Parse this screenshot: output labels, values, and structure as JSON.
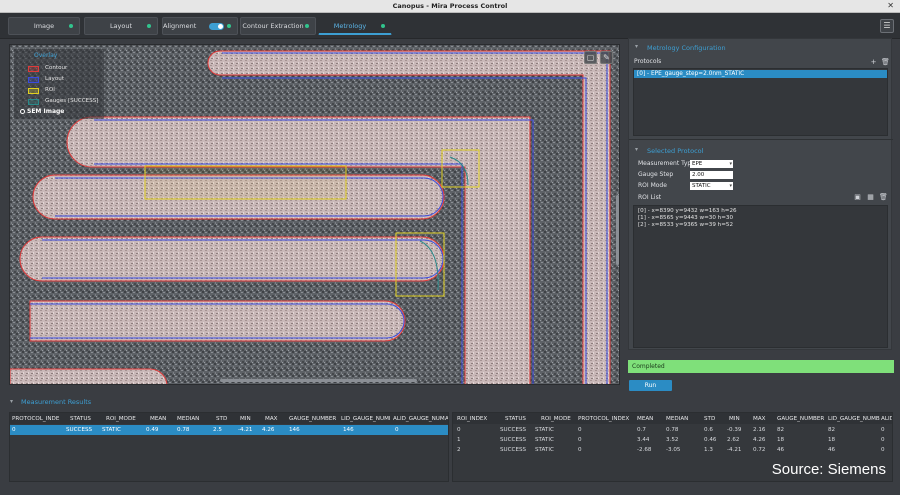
{
  "window": {
    "title": "Canopus - Mira Process Control",
    "close_glyph": "✕"
  },
  "tabs": [
    {
      "label": "Image"
    },
    {
      "label": "Layout"
    },
    {
      "label": "Alignment"
    },
    {
      "label": "Contour Extraction"
    },
    {
      "label": "Metrology"
    }
  ],
  "menu_glyph": "☰",
  "viewer": {
    "legend": {
      "header": "Overlay",
      "items": [
        {
          "label": "Contour",
          "color": "#e03a3a"
        },
        {
          "label": "Layout",
          "color": "#3a4be0"
        },
        {
          "label": "ROI",
          "color": "#e0d020"
        },
        {
          "label": "Gauges [SUCCESS]",
          "color": "#2a8a8a"
        }
      ]
    },
    "image_label": "SEM Image",
    "tool_icons": {
      "fit": "▢",
      "pen": "✎"
    }
  },
  "metrology_config": {
    "title": "Metrology Configuration",
    "protocols_label": "Protocols",
    "add_glyph": "+",
    "delete_glyph": "🗑",
    "protocols": [
      "[0] - EPE_gauge_step=2.0nm_STATIC"
    ]
  },
  "selected_protocol": {
    "title": "Selected Protocol",
    "measurement_type_label": "Measurement Type",
    "measurement_type_value": "EPE",
    "gauge_step_label": "Gauge Step",
    "gauge_step_value": "2.00",
    "roi_mode_label": "ROI Mode",
    "roi_mode_value": "STATIC",
    "roi_list_label": "ROI List",
    "roi_items": [
      "[0] - x=8390 y=9432 w=163 h=26",
      "[1] - x=8565 y=9443 w=30 h=30",
      "[2] - x=8533 y=9365 w=39 h=52"
    ]
  },
  "status_text": "Completed",
  "run_label": "Run",
  "results": {
    "title": "Measurement Results",
    "left_table": {
      "columns": [
        "PROTOCOL_INDE",
        "STATUS",
        "ROI_MODE",
        "MEAN",
        "MEDIAN",
        "STD",
        "MIN",
        "MAX",
        "GAUGE_NUMBER",
        "LID_GAUGE_NUMI",
        "ALID_GAUGE_NUM",
        "A"
      ],
      "rows": [
        [
          "0",
          "SUCCESS",
          "STATIC",
          "0.49",
          "0.78",
          "2.5",
          "-4.21",
          "4.26",
          "146",
          "146",
          "0",
          ""
        ]
      ]
    },
    "right_table": {
      "columns": [
        "ROI_INDEX",
        "STATUS",
        "ROI_MODE",
        "PROTOCOL_INDEX",
        "MEAN",
        "MEDIAN",
        "STD",
        "MIN",
        "MAX",
        "GAUGE_NUMBER",
        "LID_GAUGE_NUMB",
        "ALID"
      ],
      "rows": [
        [
          "0",
          "SUCCESS",
          "STATIC",
          "0",
          "0.7",
          "0.78",
          "0.6",
          "-0.39",
          "2.16",
          "82",
          "82",
          "0"
        ],
        [
          "1",
          "SUCCESS",
          "STATIC",
          "0",
          "3.44",
          "3.52",
          "0.46",
          "2.62",
          "4.26",
          "18",
          "18",
          "0"
        ],
        [
          "2",
          "SUCCESS",
          "STATIC",
          "0",
          "-2.68",
          "-3.05",
          "1.3",
          "-4.21",
          "0.72",
          "46",
          "46",
          "0"
        ]
      ]
    }
  },
  "watermark": "Source: Siemens"
}
